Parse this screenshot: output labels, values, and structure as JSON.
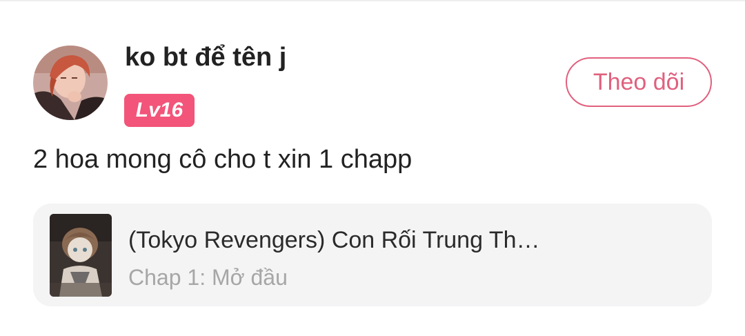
{
  "comment": {
    "user": {
      "name": "ko bt để tên j",
      "level": "Lv16",
      "avatar_icon": "user-avatar"
    },
    "follow_label": "Theo dõi",
    "text": "2 hoa mong cô cho t xin 1 chapp",
    "story": {
      "title": "(Tokyo Revengers) Con Rối Trung Th…",
      "chapter": "Chap 1: Mở đầu",
      "cover_icon": "story-cover-image"
    }
  },
  "colors": {
    "accent": "#e0607e",
    "badge": "#f2547a",
    "card_bg": "#f4f4f5",
    "muted_text": "#a6a6a6"
  }
}
